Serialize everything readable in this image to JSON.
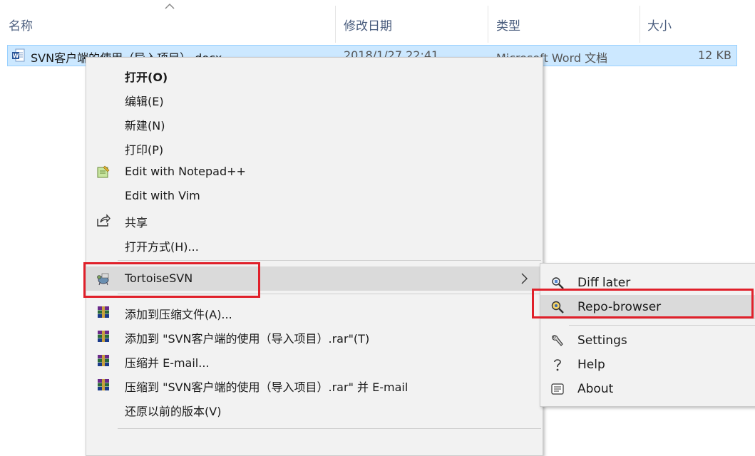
{
  "columns": {
    "name": "名称",
    "modified": "修改日期",
    "type": "类型",
    "size": "大小"
  },
  "file": {
    "name": "SVN客户端的使用（导入项目）.docx",
    "modified": "2018/1/27 22:41",
    "type": "Microsoft Word 文档",
    "size": "12 KB"
  },
  "context_menu": {
    "items": [
      {
        "label": "打开(O)",
        "icon": "none",
        "bold": true
      },
      {
        "label": "编辑(E)",
        "icon": "none"
      },
      {
        "label": "新建(N)",
        "icon": "none"
      },
      {
        "label": "打印(P)",
        "icon": "none"
      },
      {
        "label": "Edit with Notepad++",
        "icon": "notepad-plus-plus-icon"
      },
      {
        "label": "Edit with Vim",
        "icon": "none"
      },
      {
        "label": "共享",
        "icon": "share-icon"
      },
      {
        "label": "打开方式(H)...",
        "icon": "none"
      },
      {
        "label": "TortoiseSVN",
        "icon": "tortoisesvn-icon",
        "submenu": true,
        "highlighted": true
      },
      {
        "label": "添加到压缩文件(A)...",
        "icon": "winrar-icon"
      },
      {
        "label": "添加到 \"SVN客户端的使用（导入项目）.rar\"(T)",
        "icon": "winrar-icon"
      },
      {
        "label": "压缩并 E-mail...",
        "icon": "winrar-icon"
      },
      {
        "label": "压缩到 \"SVN客户端的使用（导入项目）.rar\" 并 E-mail",
        "icon": "winrar-icon"
      },
      {
        "label": "还原以前的版本(V)",
        "icon": "none"
      }
    ]
  },
  "tortoise_submenu": {
    "items": [
      {
        "label": "Diff later",
        "icon": "diff-magnifier-icon"
      },
      {
        "label": "Repo-browser",
        "icon": "repo-browser-icon",
        "highlighted": true
      },
      {
        "label": "Settings",
        "icon": "settings-icon"
      },
      {
        "label": "Help",
        "icon": "help-icon"
      },
      {
        "label": "About",
        "icon": "about-icon"
      }
    ]
  },
  "colors": {
    "selection_bg": "#cce8ff",
    "menu_bg": "#f2f2f2",
    "menu_hover": "#dadada",
    "annotation_red": "#e0202a"
  }
}
